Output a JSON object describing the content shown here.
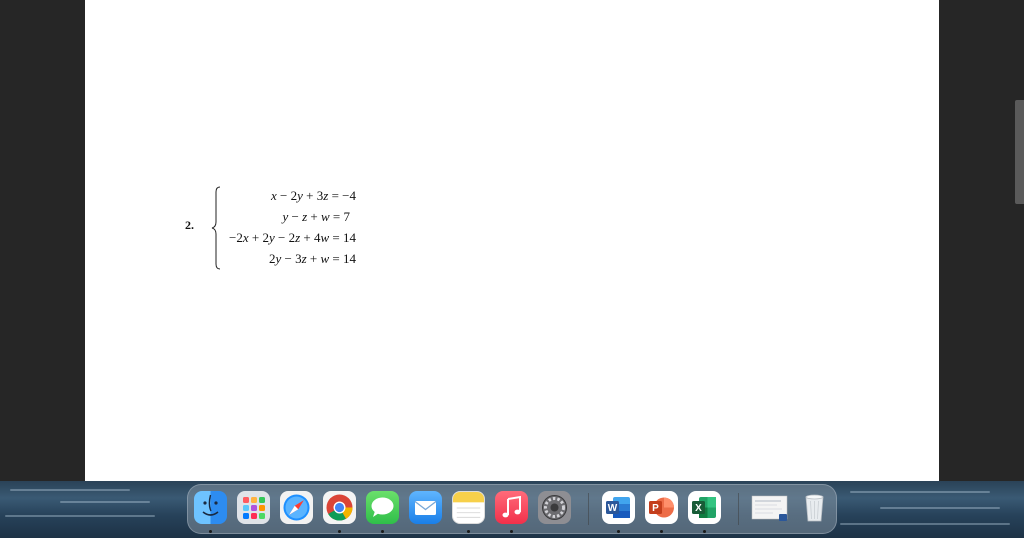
{
  "document": {
    "problem_number": "2.",
    "equations": [
      {
        "lhs_terms": [
          "x",
          " − 2",
          "y",
          " + 3",
          "z"
        ],
        "rhs": " = −4"
      },
      {
        "lhs_terms": [
          "y",
          " − ",
          "z",
          " + ",
          "w"
        ],
        "rhs": " = 7"
      },
      {
        "lhs_terms": [
          "−2",
          "x",
          " + 2",
          "y",
          " − 2",
          "z",
          " + 4",
          "w"
        ],
        "rhs": " = 14"
      },
      {
        "lhs_terms": [
          "2",
          "y",
          " − 3",
          "z",
          " + ",
          "w"
        ],
        "rhs": " = 14"
      }
    ]
  },
  "dock": {
    "apps": [
      {
        "name": "finder",
        "icon": "finder-icon",
        "running": true
      },
      {
        "name": "launchpad",
        "icon": "launchpad-icon",
        "running": false
      },
      {
        "name": "safari",
        "icon": "safari-icon",
        "running": false
      },
      {
        "name": "chrome",
        "icon": "chrome-icon",
        "running": true
      },
      {
        "name": "messages",
        "icon": "messages-icon",
        "running": true
      },
      {
        "name": "mail",
        "icon": "mail-icon",
        "running": false
      },
      {
        "name": "notes",
        "icon": "notes-icon",
        "running": true
      },
      {
        "name": "music",
        "icon": "music-icon",
        "running": true
      },
      {
        "name": "system-preferences",
        "icon": "gear-icon",
        "running": false
      },
      {
        "name": "word",
        "icon": "word-icon",
        "running": true,
        "letter": "W"
      },
      {
        "name": "powerpoint",
        "icon": "powerpoint-icon",
        "running": true,
        "letter": "P"
      },
      {
        "name": "excel",
        "icon": "excel-icon",
        "running": true,
        "letter": "X"
      },
      {
        "name": "document-preview",
        "icon": "document-thumbnail-icon",
        "running": false
      },
      {
        "name": "trash",
        "icon": "trash-icon",
        "running": false
      }
    ]
  },
  "colors": {
    "word": "#2b579a",
    "powerpoint": "#d24726",
    "excel": "#217346",
    "music": "#fa3c4c",
    "messages": "#34c759",
    "notes": "#f7d04a"
  }
}
